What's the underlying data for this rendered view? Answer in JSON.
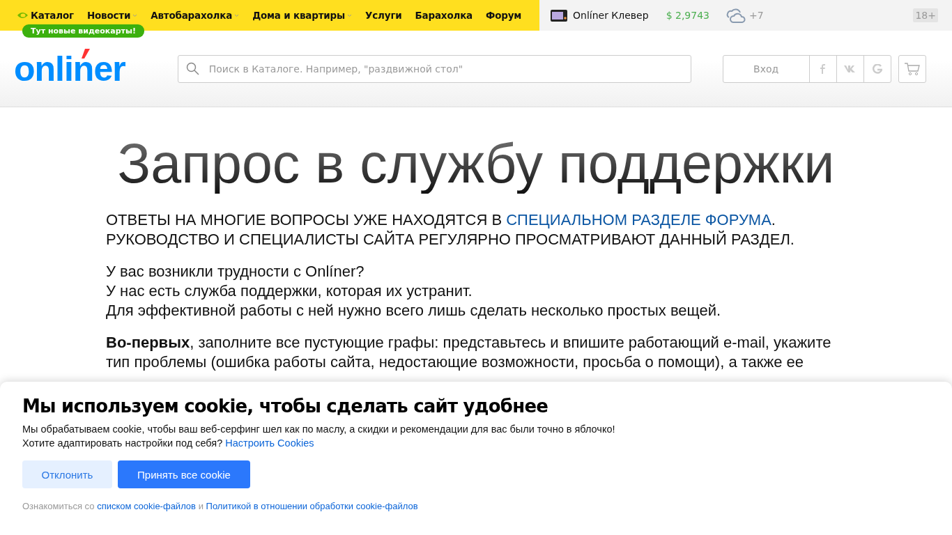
{
  "top_nav": {
    "items": [
      {
        "label": "Каталог",
        "kind": "catalog",
        "has_dropdown": false
      },
      {
        "label": "Новости",
        "kind": "plain",
        "has_dropdown": true
      },
      {
        "label": "Автобарахолка",
        "kind": "plain",
        "has_dropdown": true
      },
      {
        "label": "Дома и квартиры",
        "kind": "plain",
        "has_dropdown": true
      },
      {
        "label": "Услуги",
        "kind": "plain",
        "has_dropdown": false
      },
      {
        "label": "Барахолка",
        "kind": "plain",
        "has_dropdown": false
      },
      {
        "label": "Форум",
        "kind": "plain",
        "has_dropdown": false
      }
    ],
    "badge": "Тут новые видеокарты!"
  },
  "top_right": {
    "promo": "Onlíner Клевер",
    "currency": "$ 2,9743",
    "weather": "+7",
    "age": "18+"
  },
  "header": {
    "logo": "onliner",
    "search": {
      "placeholder": "Поиск в Каталоге. Например, \"раздвижной стол\""
    },
    "login": "Вход"
  },
  "page": {
    "title": "Запрос в службу поддержки",
    "notice": {
      "before": "ОТВЕТЫ НА МНОГИЕ ВОПРОСЫ УЖЕ НАХОДЯТСЯ В ",
      "link": "СПЕЦИАЛЬНОМ РАЗДЕЛЕ ФОРУМА",
      "after": ".",
      "line2": "РУКОВОДСТВО И СПЕЦИАЛИСТЫ САЙТА РЕГУЛЯРНО ПРОСМАТРИВАЮТ ДАННЫЙ РАЗДЕЛ."
    },
    "intro": [
      "У вас возникли трудности с Onlíner?",
      "У нас есть служба поддержки, которая их устранит.",
      "Для эффективной работы с ней нужно всего лишь сделать несколько простых вещей."
    ],
    "steps": [
      "**Во-первых**, заполните все пустующие графы: представьтесь и впишите работающий e-mail, укажите тип проблемы (ошибка работы сайта, недостающие возможности, просьба о помощи), а также ее"
    ]
  },
  "cookie": {
    "title": "Мы используем cookie, чтобы сделать сайт удобнее",
    "text": "Мы обрабатываем cookie, чтобы ваш веб-серфинг шел как по маслу, а скидки и рекомендации для вас были точно в яблочко!",
    "question": "Хотите адаптировать настройки под себя?",
    "settings_link": "Настроить Cookies",
    "reject": "Отклонить",
    "accept": "Принять все cookie",
    "footer_before": "Ознакомиться со",
    "footer_link1": "списком cookie-файлов",
    "footer_mid": "и",
    "footer_link2": "Политикой в отношении обработки cookie-файлов"
  }
}
